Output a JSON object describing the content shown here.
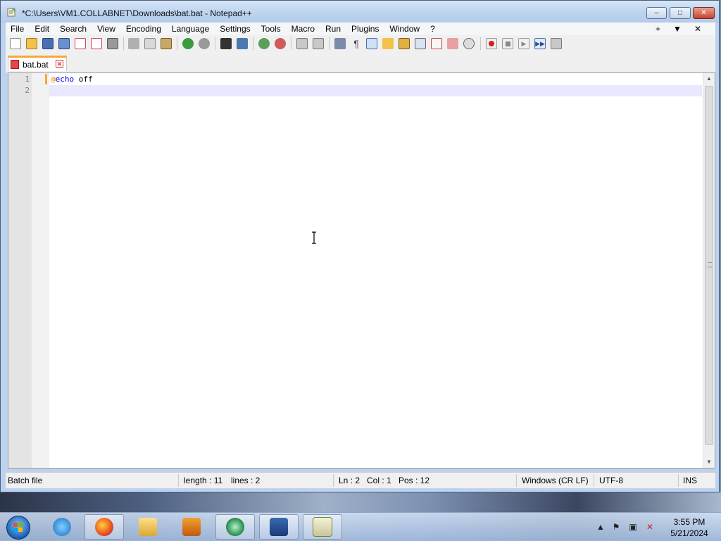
{
  "window": {
    "title": "*C:\\Users\\VM1.COLLABNET\\Downloads\\bat.bat - Notepad++",
    "controls": {
      "minimize": "–",
      "maximize": "□",
      "close": "✕"
    }
  },
  "menubar": {
    "items": [
      "File",
      "Edit",
      "Search",
      "View",
      "Encoding",
      "Language",
      "Settings",
      "Tools",
      "Macro",
      "Run",
      "Plugins",
      "Window",
      "?"
    ],
    "right": [
      "+",
      "▼",
      "✕"
    ]
  },
  "toolbar": {
    "icons": [
      "new-file-icon",
      "open-file-icon",
      "save-icon",
      "save-all-icon",
      "close-icon",
      "close-all-icon",
      "print-icon",
      "cut-icon",
      "copy-icon",
      "paste-icon",
      "undo-icon",
      "redo-icon",
      "find-icon",
      "replace-icon",
      "zoom-in-icon",
      "zoom-out-icon",
      "sync-vertical-icon",
      "sync-horizontal-icon",
      "word-wrap-icon",
      "show-all-chars-icon",
      "indent-guide-icon",
      "user-language-icon",
      "document-map-icon",
      "function-list-icon",
      "folder-workspace-icon",
      "monitoring-icon",
      "record-macro-icon",
      "stop-macro-icon",
      "play-macro-icon",
      "run-macro-multiple-icon",
      "save-macro-icon"
    ]
  },
  "tabs": [
    {
      "label": "bat.bat",
      "close": "✕"
    }
  ],
  "editor": {
    "line_numbers": [
      "1",
      "2"
    ],
    "lines": [
      {
        "at": "@",
        "keyword": "echo",
        "rest": " off"
      },
      {
        "at": "",
        "keyword": "",
        "rest": ""
      }
    ]
  },
  "statusbar": {
    "language": "Batch file",
    "length": "length : 11",
    "lines": "lines : 2",
    "ln": "Ln : 2",
    "col": "Col : 1",
    "pos": "Pos : 12",
    "eol": "Windows (CR LF)",
    "encoding": "UTF-8",
    "mode": "INS"
  },
  "taskbar": {
    "apps": [
      "internet-explorer-icon",
      "firefox-icon",
      "file-explorer-icon",
      "media-player-icon",
      "app-icon",
      "app-icon",
      "notepadpp-icon"
    ],
    "clock_time": "3:55 PM",
    "clock_date": "5/21/2024",
    "tray_icons": [
      "show-hidden-icons-icon",
      "action-center-flag-icon",
      "network-icon",
      "volume-muted-icon"
    ]
  }
}
